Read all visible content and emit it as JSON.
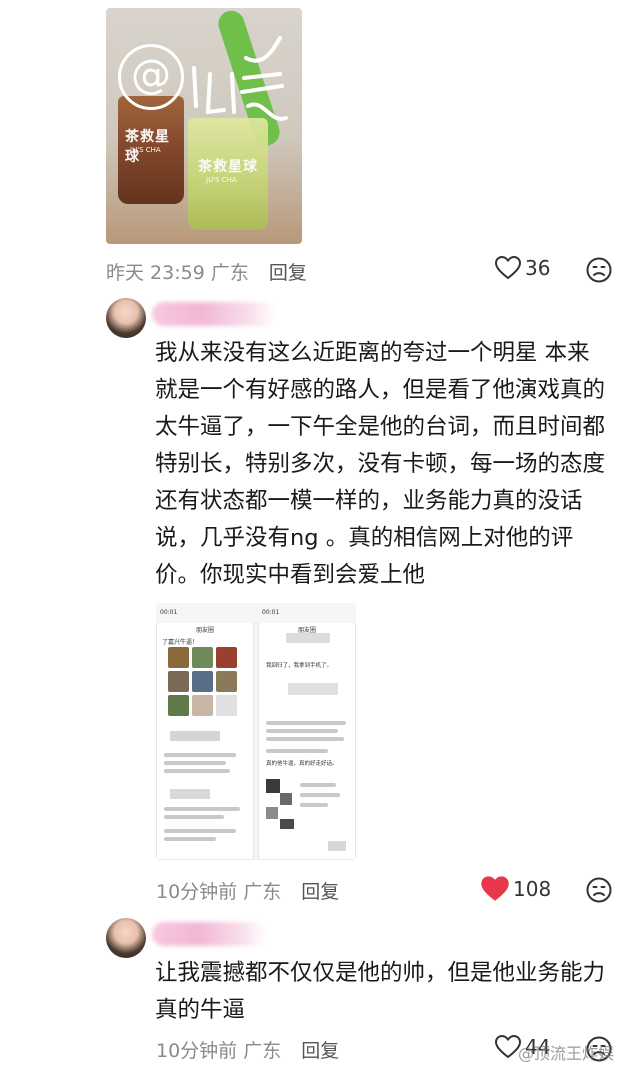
{
  "post": {
    "time": "昨天 23:59",
    "location": "广东",
    "reply_label": "回复",
    "likes": "36",
    "photo_text": {
      "cup1_brand": "茶救星球",
      "cup1_sub": "JU'S CHA",
      "cup2_brand": "茶救星球",
      "cup2_sub": "JU'S CHA"
    }
  },
  "comment1": {
    "text_lines": [
      "我从来没有这么近距离的夸过一个明星 本来",
      "就是一个有好感的路人，但是看了他演戏真的",
      "太牛逼了，一下午全是他的台词，而且时间都",
      "特别长，特别多次，没有卡顿，每一场的态度",
      "还有状态都一模一样的，业务能力真的没话",
      "说，几乎没有ng 。真的相信网上对他的评",
      "价。你现实中看到会爱上他"
    ],
    "time": "10分钟前",
    "location": "广东",
    "reply_label": "回复",
    "likes": "108",
    "liked": true,
    "screenshot": {
      "left_status": "00:01",
      "right_status": "00:01",
      "left_title": "朋友圈",
      "right_title": "朋友圈",
      "caption": "了嘉兴牛逼！",
      "right_reply": "我回归了，我拿到手机了。",
      "right_msg": "真的他牛逼，真的好走好话。"
    }
  },
  "comment2": {
    "text_lines": [
      "让我震撼都不仅仅是他的帅，但是他业务能力",
      "真的牛逼"
    ],
    "time": "10分钟前",
    "location": "广东",
    "reply_label": "回复",
    "likes": "44"
  },
  "watermark": "@顶流王炸娱",
  "colors": {
    "liked_heart": "#e8374a",
    "meta_gray": "#8a8a8a",
    "name_blur_pink": "#f2b7d6"
  }
}
